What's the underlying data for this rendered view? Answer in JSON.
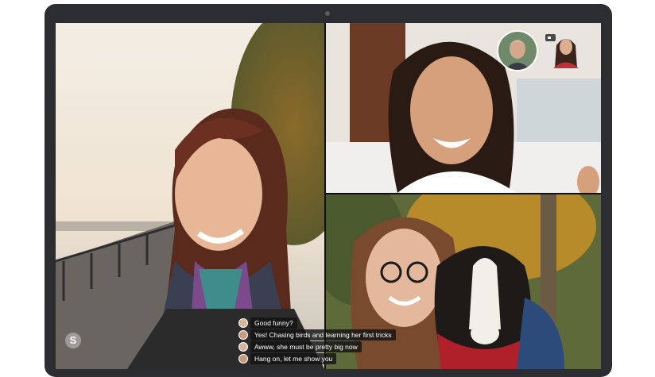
{
  "app": {
    "logo_letter": "S",
    "logo_icon": "skype-logo-icon"
  },
  "call": {
    "participants": [
      {
        "tile": "main",
        "description_icon": "video-feed-icon"
      },
      {
        "tile": "top-right",
        "description_icon": "video-feed-icon"
      },
      {
        "tile": "bottom-right",
        "description_icon": "video-feed-icon"
      }
    ],
    "self_view_icon": "camera-icon"
  },
  "captions": [
    {
      "text": "Good funny?"
    },
    {
      "text": "Yes! Chasing birds and learning her first tricks"
    },
    {
      "text": "Awww, she must be pretty big now"
    },
    {
      "text": "Hang on, let me show you"
    }
  ],
  "colors": {
    "device_frame": "#2b2d31",
    "caption_bg": "#141414"
  }
}
